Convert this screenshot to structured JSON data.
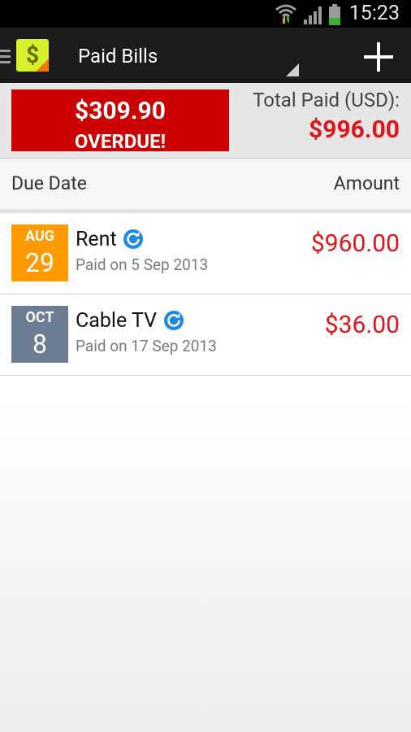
{
  "status_bar": {
    "time": "15:23"
  },
  "action_bar": {
    "title": "Paid Bills",
    "logo_glyph": "$"
  },
  "summary": {
    "overdue_amount": "$309.90",
    "overdue_label": "OVERDUE!",
    "total_label": "Total Paid (USD):",
    "total_amount": "$996.00"
  },
  "columns": {
    "due_date": "Due Date",
    "amount": "Amount"
  },
  "bills": [
    {
      "month": "AUG",
      "day": "29",
      "name": "Rent",
      "paid_on": "Paid on 5 Sep 2013",
      "amount": "$960.00",
      "tile_color": "#ff9a00"
    },
    {
      "month": "OCT",
      "day": "8",
      "name": "Cable TV",
      "paid_on": "Paid on 17 Sep 2013",
      "amount": "$36.00",
      "tile_color": "#6a7d93"
    }
  ],
  "colors": {
    "overdue": "#cc0000",
    "amount_red": "#e0151a",
    "repeat_blue": "#1e88e5"
  },
  "icons": [
    "wifi-icon",
    "signal-icon",
    "battery-icon",
    "menu-icon",
    "app-logo-icon",
    "add-icon",
    "repeat-icon"
  ]
}
